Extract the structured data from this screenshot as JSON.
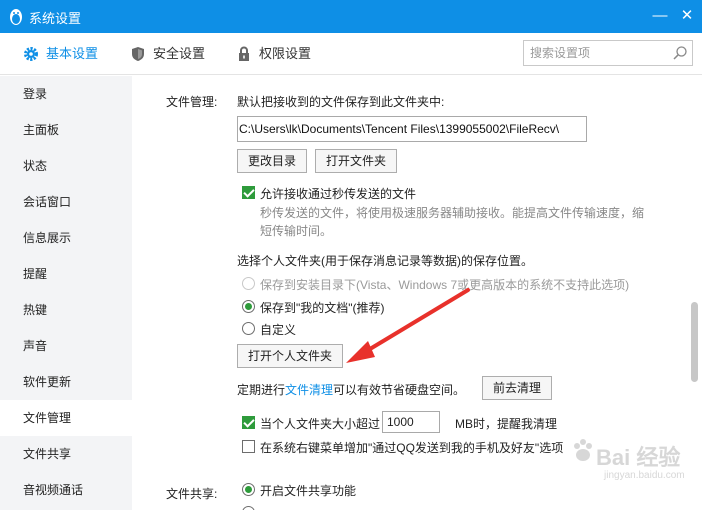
{
  "window": {
    "title": "系统设置",
    "accent": "#0e8fe6",
    "minimize_glyph": "—",
    "close_glyph": "✕"
  },
  "tabs": [
    {
      "label": "基本设置",
      "icon": "gear-icon",
      "active": true
    },
    {
      "label": "安全设置",
      "icon": "shield-icon",
      "active": false
    },
    {
      "label": "权限设置",
      "icon": "lock-icon",
      "active": false
    }
  ],
  "search": {
    "placeholder": "搜索设置项"
  },
  "sidebar": {
    "items": [
      {
        "label": "登录"
      },
      {
        "label": "主面板"
      },
      {
        "label": "状态"
      },
      {
        "label": "会话窗口"
      },
      {
        "label": "信息展示"
      },
      {
        "label": "提醒"
      },
      {
        "label": "热键"
      },
      {
        "label": "声音"
      },
      {
        "label": "软件更新"
      },
      {
        "label": "文件管理",
        "active": true
      },
      {
        "label": "文件共享"
      },
      {
        "label": "音视频通话"
      }
    ]
  },
  "file_mgmt": {
    "label": "文件管理:",
    "save_default_text": "默认把接收到的文件保存到此文件夹中:",
    "path": "C:\\Users\\lk\\Documents\\Tencent Files\\1399055002\\FileRecv\\",
    "change_dir_button": "更改目录",
    "open_folder_button": "打开文件夹",
    "allow_flash_transfer": "允许接收通过秒传发送的文件",
    "flash_desc": "秒传发送的文件，将使用极速服务器辅助接收。能提高文件传输速度，缩短传输时间。",
    "personal_folder_title": "选择个人文件夹(用于保存消息记录等数据)的保存位置。",
    "radio_install_dir": "保存到安装目录下(Vista、Windows 7或更高版本的系统不支持此选项)",
    "radio_my_docs": "保存到\"我的文档\"(推荐)",
    "radio_custom": "自定义",
    "open_personal_button": "打开个人文件夹",
    "cleanup_prefix": "定期进行",
    "cleanup_link": "文件清理",
    "cleanup_suffix": "可以有效节省硬盘空间。",
    "go_cleanup_button": "前去清理",
    "size_limit_prefix": "当个人文件夹大小超过",
    "size_limit_value": "1000",
    "size_limit_suffix": "MB时，提醒我清理",
    "context_menu_option": "在系统右键菜单增加\"通过QQ发送到我的手机及好友\"选项"
  },
  "file_share": {
    "label": "文件共享:",
    "enable_option": "开启文件共享功能"
  },
  "watermark": {
    "text": "Bai 经验",
    "url": "jingyan.baidu.com"
  }
}
